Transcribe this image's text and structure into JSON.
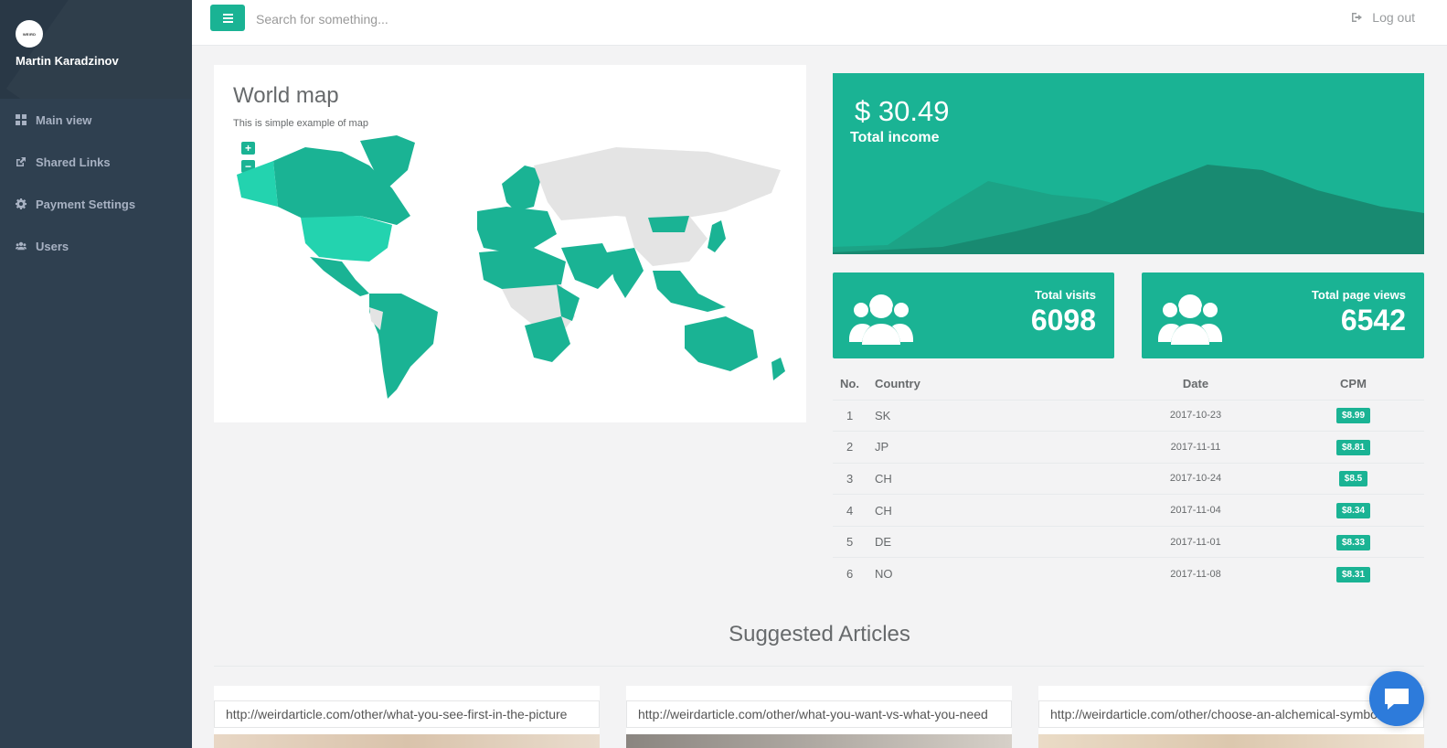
{
  "sidebar": {
    "avatar_text": "WEIRD",
    "user_name": "Martin Karadzinov",
    "items": [
      {
        "label": "Main view",
        "icon": "th-large-icon"
      },
      {
        "label": "Shared Links",
        "icon": "external-link-icon"
      },
      {
        "label": "Payment Settings",
        "icon": "gear-icon"
      },
      {
        "label": "Users",
        "icon": "users-icon"
      }
    ]
  },
  "topbar": {
    "search_placeholder": "Search for something...",
    "logout_label": "Log out"
  },
  "map": {
    "title": "World map",
    "subtitle": "This is simple example of map",
    "zoom_in": "+",
    "zoom_out": "−",
    "highlight_color": "#1ab394",
    "base_color": "#e4e4e4"
  },
  "income": {
    "amount": "$ 30.49",
    "label": "Total income"
  },
  "stats": [
    {
      "label": "Total visits",
      "value": "6098"
    },
    {
      "label": "Total page views",
      "value": "6542"
    }
  ],
  "table": {
    "headers": [
      "No.",
      "Country",
      "Date",
      "CPM"
    ],
    "rows": [
      {
        "no": "1",
        "country": "SK",
        "date": "2017-10-23",
        "cpm": "$8.99"
      },
      {
        "no": "2",
        "country": "JP",
        "date": "2017-11-11",
        "cpm": "$8.81"
      },
      {
        "no": "3",
        "country": "CH",
        "date": "2017-10-24",
        "cpm": "$8.5"
      },
      {
        "no": "4",
        "country": "CH",
        "date": "2017-11-04",
        "cpm": "$8.34"
      },
      {
        "no": "5",
        "country": "DE",
        "date": "2017-11-01",
        "cpm": "$8.33"
      },
      {
        "no": "6",
        "country": "NO",
        "date": "2017-11-08",
        "cpm": "$8.31"
      }
    ]
  },
  "suggested": {
    "title": "Suggested Articles",
    "articles": [
      {
        "url": "http://weirdarticle.com/other/what-you-see-first-in-the-picture"
      },
      {
        "url": "http://weirdarticle.com/other/what-you-want-vs-what-you-need"
      },
      {
        "url": "http://weirdarticle.com/other/choose-an-alchemical-symbol"
      }
    ]
  },
  "colors": {
    "accent": "#1ab394",
    "sidebar": "#2f4050",
    "chat": "#2d7bdb"
  }
}
